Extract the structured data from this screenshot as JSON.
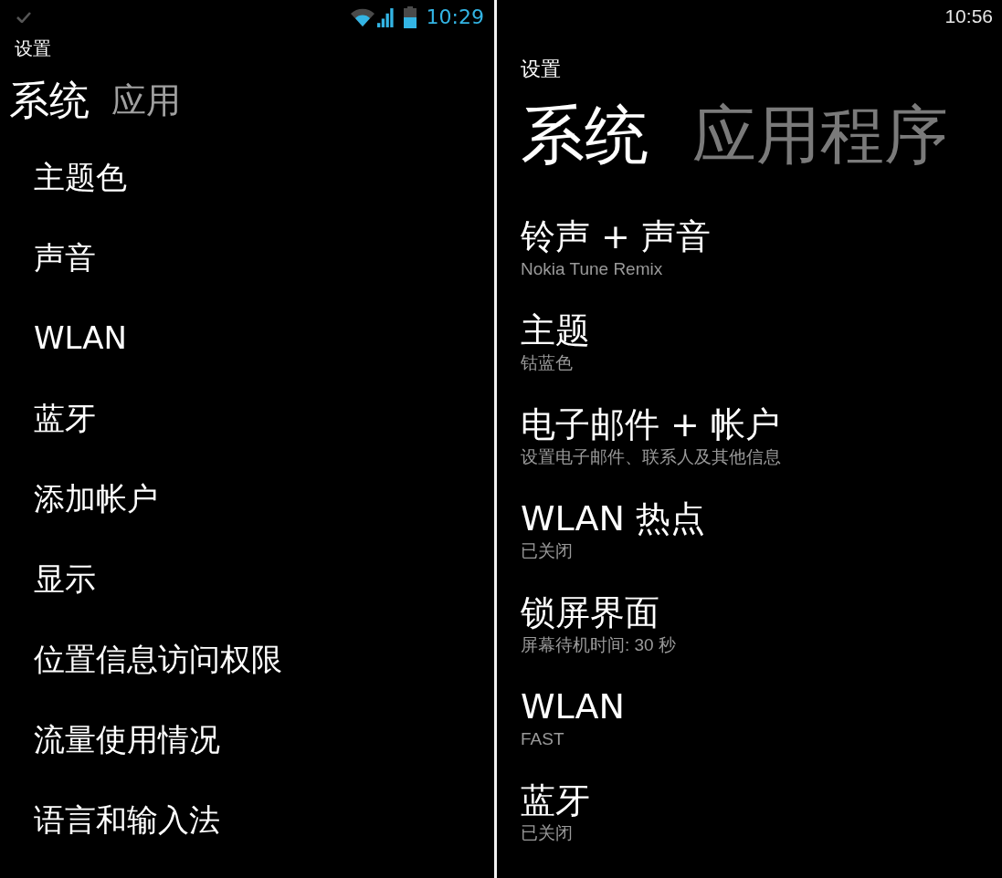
{
  "left_screen": {
    "status_bar": {
      "time": "10:29"
    },
    "title": "设置",
    "tabs": [
      {
        "label": "系统",
        "selected": true
      },
      {
        "label": "应用",
        "selected": false
      }
    ],
    "items": [
      {
        "label": "主题色"
      },
      {
        "label": "声音"
      },
      {
        "label": "WLAN"
      },
      {
        "label": "蓝牙"
      },
      {
        "label": "添加帐户"
      },
      {
        "label": "显示"
      },
      {
        "label": "位置信息访问权限"
      },
      {
        "label": "流量使用情况"
      },
      {
        "label": "语言和输入法"
      }
    ]
  },
  "right_screen": {
    "status_bar": {
      "time": "10:56"
    },
    "title": "设置",
    "tabs": [
      {
        "label": "系统",
        "selected": true
      },
      {
        "label": "应用程序",
        "selected": false
      }
    ],
    "items": [
      {
        "title": "铃声 + 声音",
        "subtitle": "Nokia Tune Remix"
      },
      {
        "title": "主题",
        "subtitle": "钴蓝色"
      },
      {
        "title": "电子邮件 + 帐户",
        "subtitle": "设置电子邮件、联系人及其他信息"
      },
      {
        "title": "WLAN 热点",
        "subtitle": "已关闭"
      },
      {
        "title": "锁屏界面",
        "subtitle": "屏幕待机时间: 30 秒"
      },
      {
        "title": "WLAN",
        "subtitle": "FAST"
      },
      {
        "title": "蓝牙",
        "subtitle": "已关闭"
      }
    ]
  }
}
